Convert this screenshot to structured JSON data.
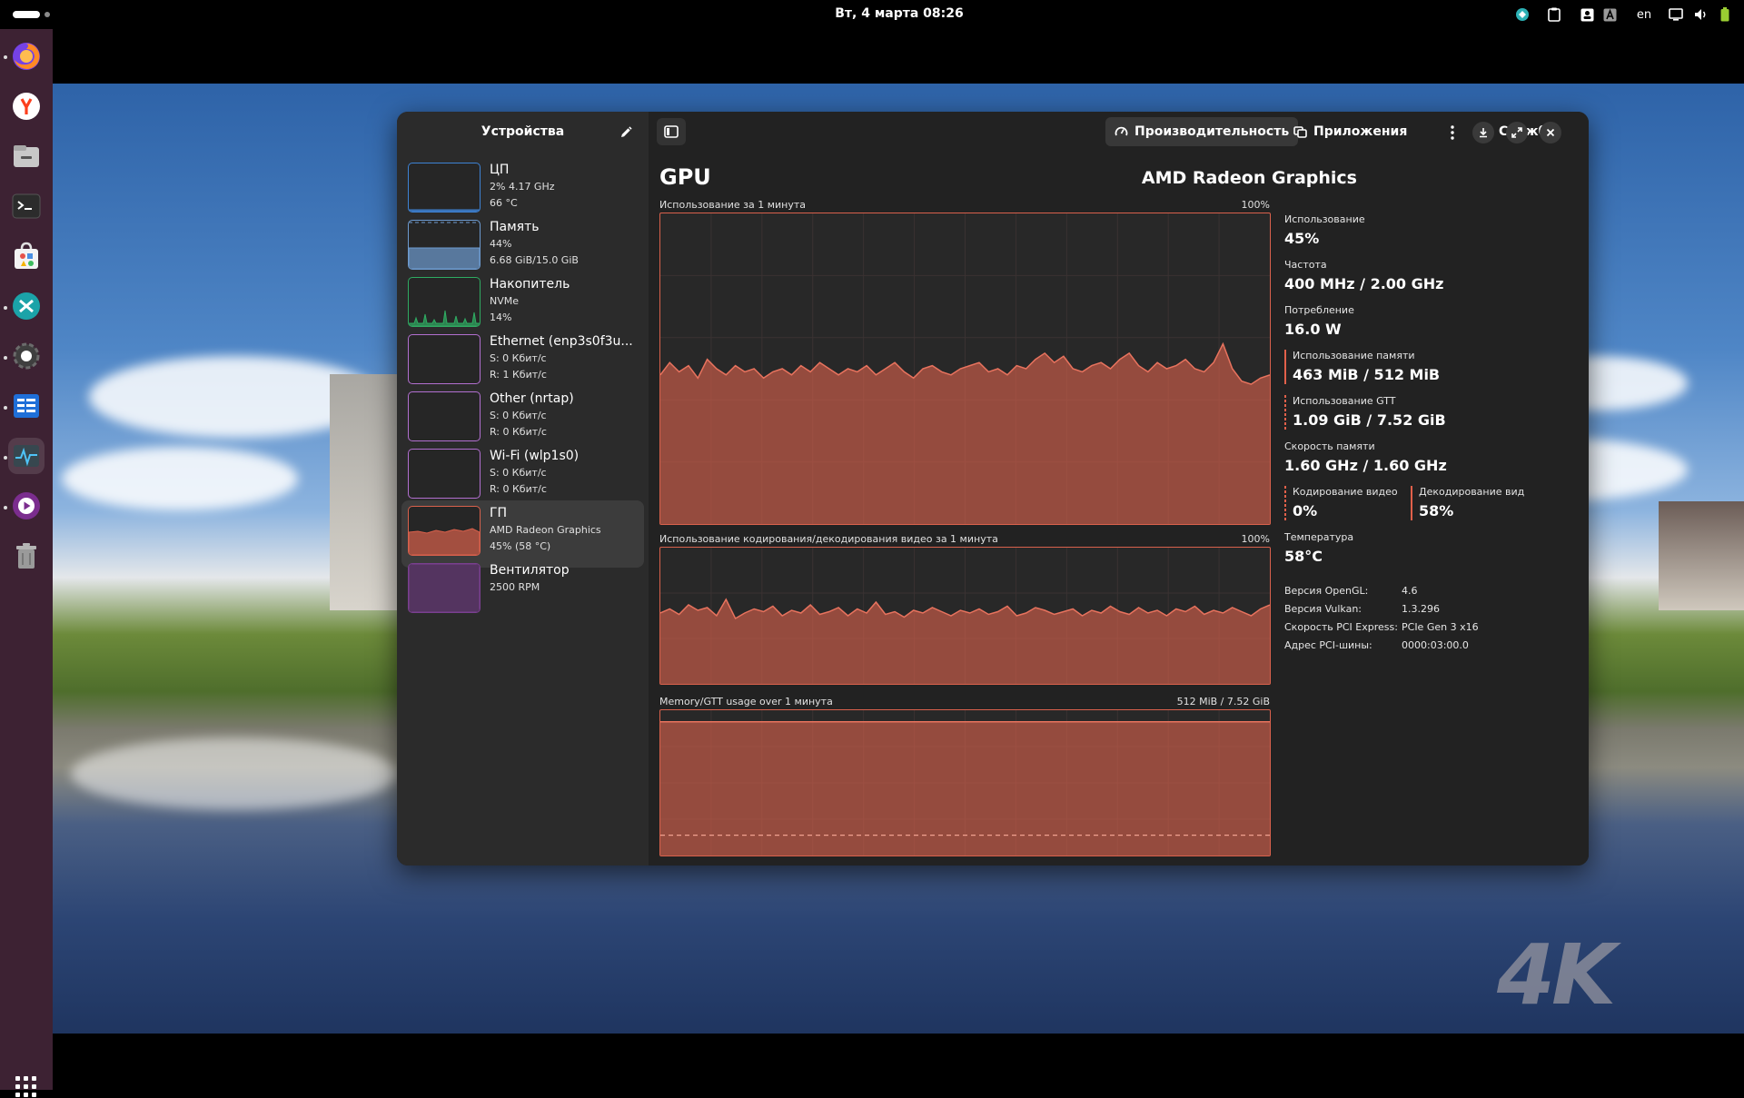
{
  "topbar": {
    "clock": "Вт, 4 марта  08:26",
    "language": "en"
  },
  "dock": {
    "items": [
      {
        "name": "firefox-icon",
        "color": "#ff7139"
      },
      {
        "name": "yandex-browser-icon",
        "color": "#ffffff"
      },
      {
        "name": "files-icon",
        "color": "#b3b3b3"
      },
      {
        "name": "terminal-icon",
        "color": "#2d2d2d"
      },
      {
        "name": "software-center-icon",
        "color": "#f2f2f2"
      },
      {
        "name": "remote-desktop-icon",
        "color": "#1ca9a9"
      },
      {
        "name": "settings-icon",
        "color": "#4a4a4a"
      },
      {
        "name": "planner-icon",
        "color": "#1f6fd8"
      },
      {
        "name": "system-monitor-icon",
        "color": "#3b4a55"
      },
      {
        "name": "media-player-icon",
        "color": "#8c2f9e"
      },
      {
        "name": "trash-icon",
        "color": "#9a9a9a"
      }
    ]
  },
  "sidebar": {
    "title": "Устройства",
    "devices": [
      {
        "name": "ЦП",
        "line1": "2% 4.17 GHz",
        "line2": "66 °C",
        "color": "#3d82d4"
      },
      {
        "name": "Память",
        "line1": "44%",
        "line2": "6.68 GiB/15.0 GiB",
        "color": "#6d9bd0"
      },
      {
        "name": "Накопитель",
        "line1": "NVMe",
        "line2": "14%",
        "color": "#2fab62"
      },
      {
        "name": "Ethernet (enp3s0f3u...",
        "line1": "S: 0 Кбит/с",
        "line2": "R: 1 Кбит/с",
        "color": "#b26fd0"
      },
      {
        "name": "Other (nrtap)",
        "line1": "S: 0 Кбит/с",
        "line2": "R: 0 Кбит/с",
        "color": "#b26fd0"
      },
      {
        "name": "Wi-Fi (wlp1s0)",
        "line1": "S: 0 Кбит/с",
        "line2": "R: 0 Кбит/с",
        "color": "#b26fd0"
      },
      {
        "name": "ГП",
        "line1": "AMD Radeon Graphics",
        "line2": "45% (58 °C)",
        "color": "#d9614c"
      },
      {
        "name": "Вентилятор",
        "line1": "2500 RPM",
        "line2": "",
        "color": "#7a3f90"
      }
    ]
  },
  "header": {
    "tabs": [
      "Производительность",
      "Приложения",
      "Службы"
    ]
  },
  "gpu": {
    "title": "GPU",
    "model": "AMD Radeon Graphics",
    "graph1_label": "Использование за 1 минута",
    "graph1_max": "100%",
    "graph2_label": "Использование кодирования/декодирования видео за 1 минута",
    "graph2_max": "100%",
    "graph3_label": "Memory/GTT usage over 1 минута",
    "graph3_max": "512 MiB / 7.52 GiB",
    "usage_series": [
      48,
      52,
      49,
      51,
      47,
      53,
      50,
      48,
      51,
      49,
      50,
      47,
      49,
      50,
      48,
      51,
      49,
      52,
      50,
      48,
      50,
      49,
      51,
      48,
      50,
      52,
      49,
      47,
      50,
      51,
      49,
      48,
      50,
      51,
      52,
      49,
      50,
      48,
      51,
      50,
      53,
      55,
      52,
      54,
      50,
      49,
      51,
      52,
      50,
      53,
      55,
      51,
      49,
      52,
      50,
      51,
      53,
      50,
      49,
      52,
      58,
      50,
      46,
      45,
      47,
      48
    ],
    "codec_series": [
      52,
      55,
      51,
      58,
      54,
      56,
      50,
      62,
      48,
      52,
      55,
      53,
      57,
      50,
      54,
      52,
      58,
      51,
      53,
      56,
      50,
      55,
      52,
      60,
      51,
      53,
      49,
      54,
      52,
      56,
      53,
      50,
      54,
      52,
      55,
      51,
      53,
      57,
      50,
      52,
      56,
      54,
      51,
      53,
      55,
      50,
      54,
      52,
      57,
      53,
      51,
      56,
      52,
      54,
      50,
      55,
      53,
      57,
      51,
      54,
      52,
      56,
      53,
      50,
      55,
      58
    ],
    "memory_series": [
      92,
      92,
      92,
      92,
      92,
      92,
      92,
      92,
      92,
      92,
      92,
      92,
      92,
      92,
      92,
      92,
      92,
      92,
      92,
      92,
      92,
      92,
      92,
      92,
      92,
      92,
      92,
      92,
      92,
      92,
      92,
      92,
      92,
      92,
      92,
      92,
      92,
      92,
      92,
      92,
      92,
      92,
      92,
      92,
      92,
      92,
      92,
      92,
      92,
      92,
      92,
      92,
      92,
      92,
      92,
      92,
      92,
      92,
      92,
      92,
      92,
      92,
      92,
      92,
      92,
      92
    ],
    "gtt_series": [
      14,
      14,
      14,
      14,
      14,
      14,
      14,
      14,
      14,
      14,
      14,
      14,
      14,
      14,
      14,
      14,
      14,
      14,
      14,
      14,
      14,
      14,
      14,
      14,
      14,
      14,
      14,
      14,
      14,
      14,
      14,
      14,
      14,
      14,
      14,
      14,
      14,
      14,
      14,
      14,
      14,
      14,
      14,
      14,
      14,
      14,
      14,
      14,
      14,
      14,
      14,
      14,
      14,
      14,
      14,
      14,
      14,
      14,
      14,
      14,
      14,
      14,
      14,
      14,
      14,
      14
    ]
  },
  "stats": {
    "usage_label": "Использование",
    "usage_value": "45%",
    "freq_label": "Частота",
    "freq_value": "400 MHz / 2.00 GHz",
    "power_label": "Потребление",
    "power_value": "16.0 W",
    "mem_label": "Использование памяти",
    "mem_value": "463 MiB / 512 MiB",
    "gtt_label": "Использование GTT",
    "gtt_value": "1.09 GiB / 7.52 GiB",
    "memspeed_label": "Скорость памяти",
    "memspeed_value": "1.60 GHz / 1.60 GHz",
    "encode_label": "Кодирование видео",
    "encode_value": "0%",
    "decode_label": "Декодирование вид",
    "decode_value": "58%",
    "temp_label": "Температура",
    "temp_value": "58°C"
  },
  "info": {
    "opengl_label": "Версия OpenGL:",
    "opengl_value": "4.6",
    "vulkan_label": "Версия Vulkan:",
    "vulkan_value": "1.3.296",
    "pcie_label": "Скорость PCI Express:",
    "pcie_value": "PCIe Gen 3 x16",
    "pci_addr_label": "Адрес PCI-шины:",
    "pci_addr_value": "0000:03:00.0"
  },
  "wallpaper": {
    "badge": "4K"
  }
}
